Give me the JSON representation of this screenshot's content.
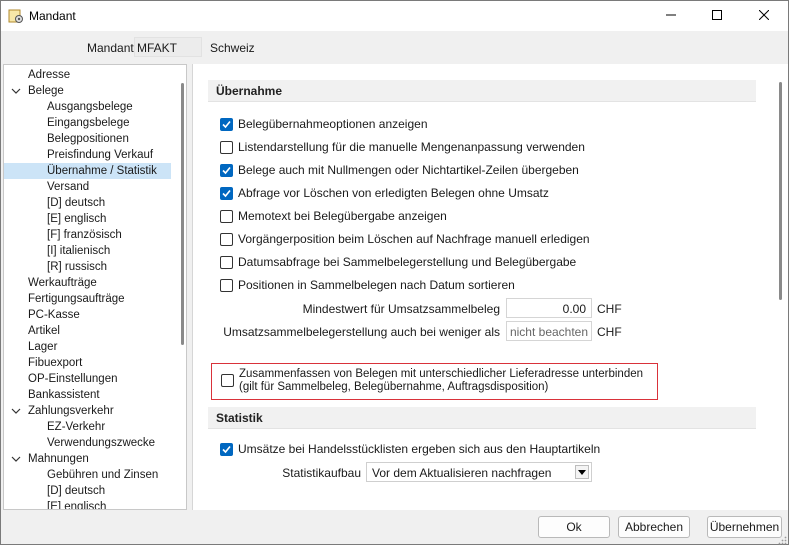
{
  "window": {
    "title": "Mandant",
    "icons": {
      "app": "app-gear-icon",
      "minimize": "minimize-icon",
      "maximize": "maximize-icon",
      "close": "close-icon"
    }
  },
  "header": {
    "mandant_label": "Mandant",
    "mandant_value": "MFAKT",
    "country": "Schweiz"
  },
  "tree": {
    "items": [
      {
        "label": "Adresse",
        "level": 0,
        "expanded": null
      },
      {
        "label": "Belege",
        "level": 0,
        "expanded": true
      },
      {
        "label": "Ausgangsbelege",
        "level": 1,
        "expanded": null
      },
      {
        "label": "Eingangsbelege",
        "level": 1,
        "expanded": null
      },
      {
        "label": "Belegpositionen",
        "level": 1,
        "expanded": null
      },
      {
        "label": "Preisfindung Verkauf",
        "level": 1,
        "expanded": null
      },
      {
        "label": "Übernahme / Statistik",
        "level": 1,
        "expanded": null,
        "selected": true
      },
      {
        "label": "Versand",
        "level": 1,
        "expanded": null
      },
      {
        "label": "[D]  deutsch",
        "level": 1,
        "expanded": null
      },
      {
        "label": "[E]  englisch",
        "level": 1,
        "expanded": null
      },
      {
        "label": "[F]  französisch",
        "level": 1,
        "expanded": null
      },
      {
        "label": "[I]  italienisch",
        "level": 1,
        "expanded": null
      },
      {
        "label": "[R]  russisch",
        "level": 1,
        "expanded": null
      },
      {
        "label": "Werkaufträge",
        "level": 0,
        "expanded": null
      },
      {
        "label": "Fertigungsaufträge",
        "level": 0,
        "expanded": null
      },
      {
        "label": "PC-Kasse",
        "level": 0,
        "expanded": null
      },
      {
        "label": "Artikel",
        "level": 0,
        "expanded": null
      },
      {
        "label": "Lager",
        "level": 0,
        "expanded": null
      },
      {
        "label": "Fibuexport",
        "level": 0,
        "expanded": null
      },
      {
        "label": "OP-Einstellungen",
        "level": 0,
        "expanded": null
      },
      {
        "label": "Bankassistent",
        "level": 0,
        "expanded": null
      },
      {
        "label": "Zahlungsverkehr",
        "level": 0,
        "expanded": true
      },
      {
        "label": "EZ-Verkehr",
        "level": 1,
        "expanded": null
      },
      {
        "label": "Verwendungszwecke",
        "level": 1,
        "expanded": null
      },
      {
        "label": "Mahnungen",
        "level": 0,
        "expanded": true
      },
      {
        "label": "Gebühren und Zinsen",
        "level": 1,
        "expanded": null
      },
      {
        "label": "[D]  deutsch",
        "level": 1,
        "expanded": null
      },
      {
        "label": "[E]  englisch",
        "level": 1,
        "expanded": null
      }
    ]
  },
  "uebernahme": {
    "title": "Übernahme",
    "options": [
      {
        "label": "Belegübernahmeoptionen anzeigen",
        "checked": true
      },
      {
        "label": "Listendarstellung für die manuelle Mengenanpassung verwenden",
        "checked": false
      },
      {
        "label": "Belege auch mit Nullmengen oder Nichtartikel-Zeilen übergeben",
        "checked": true
      },
      {
        "label": "Abfrage vor Löschen von erledigten Belegen ohne Umsatz",
        "checked": true
      },
      {
        "label": "Memotext bei Belegübergabe anzeigen",
        "checked": false
      },
      {
        "label": "Vorgängerposition beim Löschen auf Nachfrage manuell erledigen",
        "checked": false
      },
      {
        "label": "Datumsabfrage bei Sammelbelegerstellung und Belegübergabe",
        "checked": false
      },
      {
        "label": "Positionen in Sammelbelegen nach Datum sortieren",
        "checked": false
      }
    ],
    "min_value_label": "Mindestwert für Umsatzsammelbeleg",
    "min_value": "0.00",
    "min_value_unit": "CHF",
    "create_label": "Umsatzsammelbelegerstellung auch bei weniger als",
    "create_value": "nicht beachten",
    "create_unit": "CHF",
    "combine_line1": "Zusammenfassen von Belegen mit unterschiedlicher Lieferadresse unterbinden",
    "combine_line2": "(gilt für Sammelbeleg, Belegübernahme, Auftragsdisposition)",
    "combine_checked": false
  },
  "statistik": {
    "title": "Statistik",
    "option_label": "Umsätze bei Handelsstücklisten ergeben sich aus den Hauptartikeln",
    "option_checked": true,
    "aufbau_label": "Statistikaufbau",
    "aufbau_value": "Vor dem Aktualisieren nachfragen"
  },
  "footer": {
    "ok": "Ok",
    "cancel": "Abbrechen",
    "apply": "Übernehmen"
  },
  "colors": {
    "accent": "#0067c0",
    "selection": "#cce4f7",
    "highlight_border": "#d9323a"
  }
}
